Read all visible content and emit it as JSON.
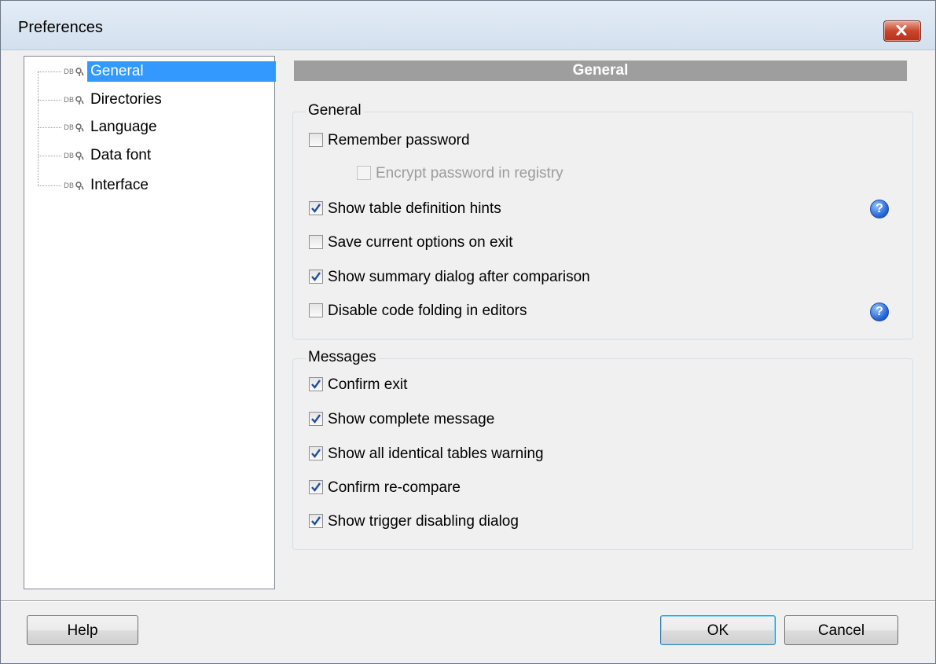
{
  "window": {
    "title": "Preferences"
  },
  "tree": {
    "items": [
      {
        "label": "General",
        "selected": true
      },
      {
        "label": "Directories",
        "selected": false
      },
      {
        "label": "Language",
        "selected": false
      },
      {
        "label": "Data font",
        "selected": false
      },
      {
        "label": "Interface",
        "selected": false
      }
    ]
  },
  "panel": {
    "header": "General",
    "general_group": {
      "title": "General",
      "remember_password": {
        "label": "Remember password",
        "checked": false
      },
      "encrypt_password": {
        "label": "Encrypt password in registry",
        "checked": false,
        "enabled": false
      },
      "show_table_hints": {
        "label": "Show table definition hints",
        "checked": true
      },
      "save_options": {
        "label": "Save current options on exit",
        "checked": false
      },
      "show_summary": {
        "label": "Show summary dialog after comparison",
        "checked": true
      },
      "disable_folding": {
        "label": "Disable code folding in editors",
        "checked": false
      }
    },
    "messages_group": {
      "title": "Messages",
      "confirm_exit": {
        "label": "Confirm exit",
        "checked": true
      },
      "show_complete": {
        "label": "Show complete message",
        "checked": true
      },
      "show_identical": {
        "label": "Show all identical tables warning",
        "checked": true
      },
      "confirm_recompare": {
        "label": "Confirm re-compare",
        "checked": true
      },
      "show_trigger": {
        "label": "Show trigger disabling dialog",
        "checked": true
      }
    }
  },
  "buttons": {
    "help": "Help",
    "ok": "OK",
    "cancel": "Cancel"
  },
  "icons": {
    "close": "close-icon",
    "help": "help-icon",
    "tree": "tree-node-icon",
    "check": "check-icon"
  },
  "colors": {
    "selection": "#3399ff",
    "header": "#9e9e9e",
    "check": "#1e4f9c"
  }
}
